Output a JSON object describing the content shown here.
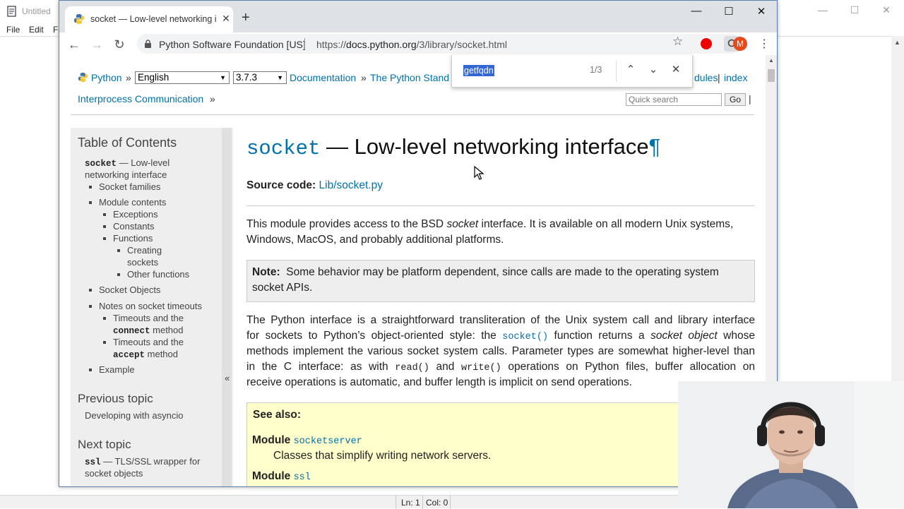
{
  "notepad": {
    "title": "Untitled",
    "menus": [
      "File",
      "Edit",
      "F"
    ],
    "status": {
      "line": "Ln: 1",
      "col": "Col: 0"
    }
  },
  "browser": {
    "tab_title": "socket — Low-level networking i",
    "site_owner": "Python Software Foundation [US]",
    "url_scheme": "https://",
    "url_host": "docs.python.org",
    "url_path": "/3/library/socket.html",
    "avatar_letter": "M"
  },
  "findbar": {
    "query": "getfqdn",
    "count": "1/3"
  },
  "related": {
    "python_label": "Python",
    "sep": "»",
    "language": "English",
    "version": "3.7.3",
    "documentation": "Documentation",
    "standard_lib": "The Python Stand",
    "modules_tail": "dules",
    "pipe": "|",
    "index": "index",
    "ipc": "Interprocess Communication",
    "search_placeholder": "Quick search",
    "go": "Go"
  },
  "sidebar": {
    "toc_heading": "Table of Contents",
    "toc_root_code": "socket",
    "toc_root_text": "— Low-level",
    "toc_root_text2": "networking interface",
    "items": [
      "Socket families",
      "Module contents",
      "Exceptions",
      "Constants",
      "Functions",
      "Creating",
      "sockets",
      "Other functions",
      "Socket Objects",
      "Notes on socket timeouts",
      "Timeouts and the",
      "connect",
      "method",
      "Timeouts and the",
      "accept",
      "method",
      "Example"
    ],
    "collapse": "«",
    "prev_heading": "Previous topic",
    "prev_link": "Developing with asyncio",
    "next_heading": "Next topic",
    "next_code": "ssl",
    "next_text": "— TLS/SSL wrapper for",
    "next_text2": "socket objects"
  },
  "main": {
    "h1_code": "socket",
    "h1_text": "— Low-level networking interface",
    "pilcrow": "¶",
    "source_label": "Source code:",
    "source_link": "Lib/socket.py",
    "p1a": "This module provides access to the BSD ",
    "p1em": "socket",
    "p1b": " interface. It is available on all modern Unix systems,",
    "p1c": "Windows, MacOS, and probably additional platforms.",
    "note_label": "Note:",
    "note_a": "Some behavior may be platform dependent, since calls are made to the operating system",
    "note_b": "socket APIs.",
    "p2l1": "The Python interface is a straightforward transliteration of the Unix system call and library interface",
    "p2l2a": "for sockets to Python’s object-oriented style: the ",
    "p2l2code": "socket()",
    "p2l2b": " function returns a ",
    "p2l2em": "socket object",
    "p2l2c": " whose",
    "p2l3": "methods implement the various socket system calls. Parameter types are somewhat higher-level than",
    "p2l4a": "in the C interface: as with ",
    "p2l4code1": "read()",
    "p2l4b": " and ",
    "p2l4code2": "write()",
    "p2l4c": " operations on Python files, buffer allocation on",
    "p2l5": "receive operations is automatic, and buffer length is implicit on send operations.",
    "seealso": "See also:",
    "module1_label": "Module",
    "module1_code": "socketserver",
    "module1_desc": "Classes that simplify writing network servers.",
    "module2_label": "Module",
    "module2_code": "ssl"
  }
}
